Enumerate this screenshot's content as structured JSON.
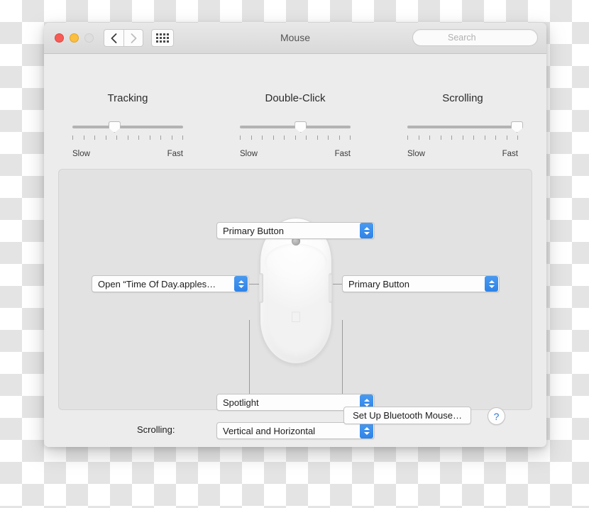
{
  "window": {
    "title": "Mouse",
    "traffic_lights": {
      "close": "close-button",
      "minimize": "minimize-button",
      "maximize": "maximize-button"
    },
    "nav": {
      "back": "‹",
      "forward": "›",
      "grid": "show-all-icon"
    },
    "search": {
      "placeholder": "Search",
      "value": "",
      "icon": "search-icon",
      "clear": "clear-icon"
    }
  },
  "sliders": [
    {
      "title": "Tracking",
      "min_label": "Slow",
      "max_label": "Fast",
      "value_percent": 38,
      "ticks": 11
    },
    {
      "title": "Double-Click",
      "min_label": "Slow",
      "max_label": "Fast",
      "value_percent": 55,
      "ticks": 11
    },
    {
      "title": "Scrolling",
      "min_label": "Slow",
      "max_label": "Fast",
      "value_percent": 99,
      "ticks": 11
    }
  ],
  "popups": {
    "top": {
      "value": "Primary Button"
    },
    "left": {
      "value": "Open “Time Of Day.apples…"
    },
    "right": {
      "value": "Primary Button"
    },
    "bottom": {
      "value": "Spotlight"
    },
    "scrolling": {
      "label": "Scrolling:",
      "value": "Vertical and Horizontal"
    }
  },
  "mouse_illustration": {
    "scroll_ball": "scroll-ball",
    "apple_logo": "",
    "side_button_left": "side-button-left",
    "side_button_right": "side-button-right"
  },
  "footer": {
    "bluetooth_button": "Set Up Bluetooth Mouse…",
    "help_button": "?"
  },
  "colors": {
    "accent_blue": "#2d83e8",
    "help_blue": "#2d7ad6",
    "window_bg": "#ececec",
    "panel_bg": "#e2e2e2",
    "close_red": "#f65b56",
    "minimize_yellow": "#fbbe3f",
    "maximize_gray": "#dedede"
  }
}
